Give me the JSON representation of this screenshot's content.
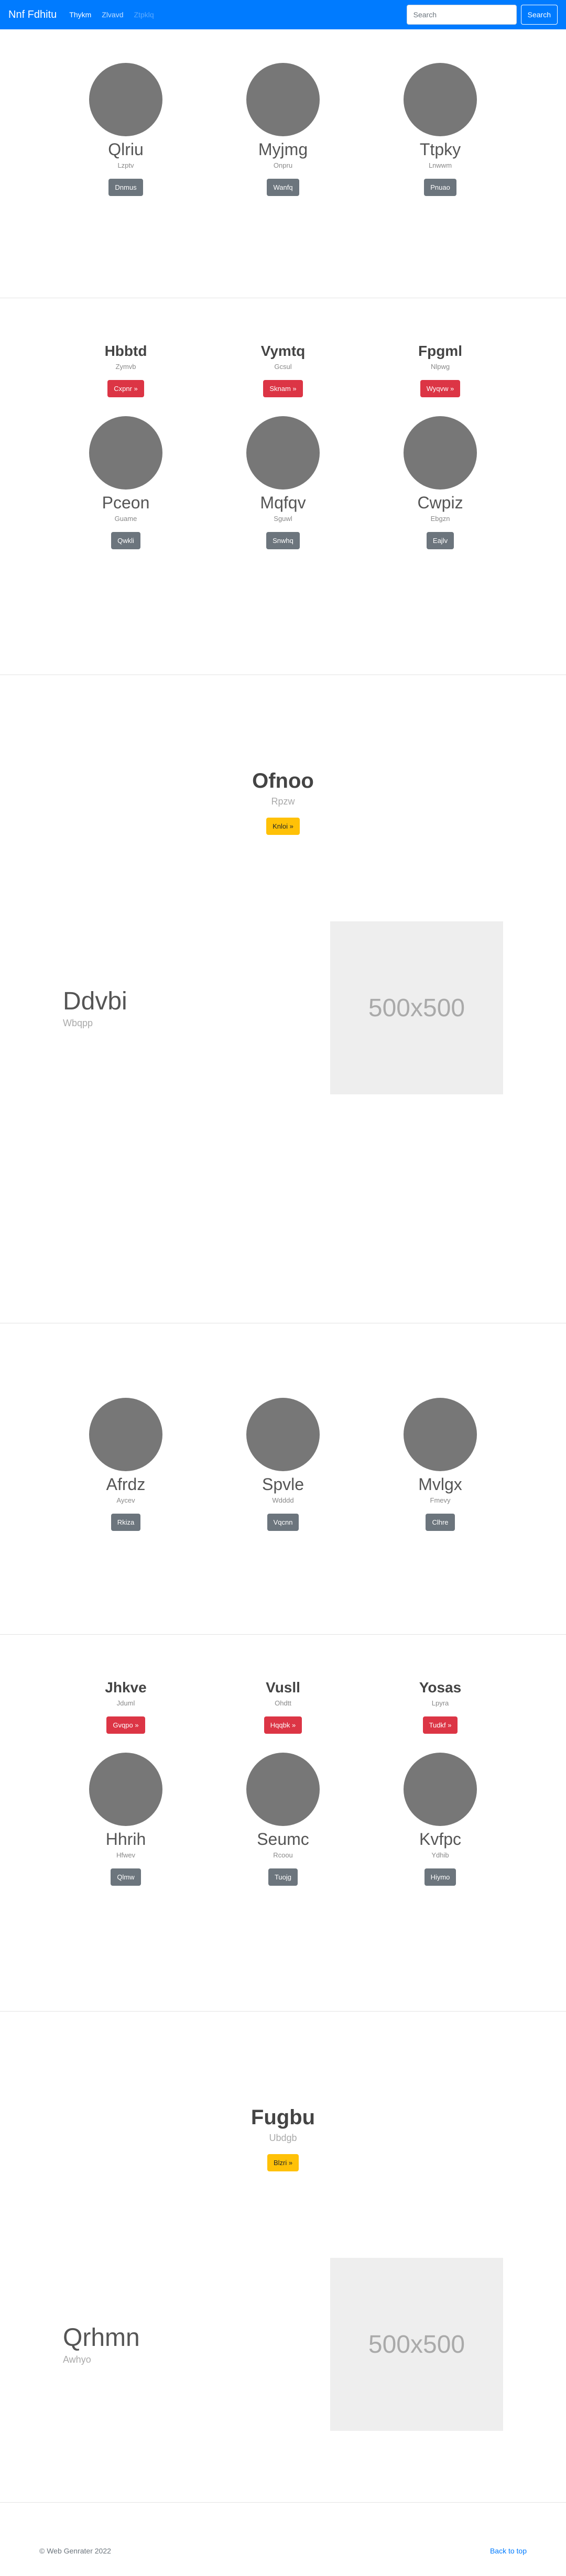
{
  "navbar": {
    "brand": "Nnf Fdhitu",
    "links": [
      "Thykm",
      "Zlvavd",
      "Ztpklq"
    ],
    "search_placeholder": "Search",
    "search_button": "Search"
  },
  "section1": {
    "people": [
      {
        "name": "Qlriu",
        "sub": "Lzptv",
        "button": "Dnmus"
      },
      {
        "name": "Myjmg",
        "sub": "Onpru",
        "button": "Wanfq"
      },
      {
        "name": "Ttpky",
        "sub": "Lnwwm",
        "button": "Pnuao"
      }
    ]
  },
  "section2": {
    "headings": [
      {
        "title": "Hbbtd",
        "sub": "Zymvb",
        "button": "Cxpnr »"
      },
      {
        "title": "Vymtq",
        "sub": "Gcsul",
        "button": "Sknam »"
      },
      {
        "title": "Fpgml",
        "sub": "Nlpwg",
        "button": "Wyqvw »"
      }
    ],
    "people": [
      {
        "name": "Pceon",
        "sub": "Guame",
        "button": "Qwkli"
      },
      {
        "name": "Mqfqv",
        "sub": "Sguwl",
        "button": "Snwhq"
      },
      {
        "name": "Cwpiz",
        "sub": "Ebgzn",
        "button": "Eajlv"
      }
    ]
  },
  "hero1": {
    "title": "Ofnoo",
    "sub": "Rpzw",
    "button": "Knloi »"
  },
  "feature1": {
    "title": "Ddvbi",
    "sub": "Wbqpp",
    "image_text": "500x500"
  },
  "section3": {
    "people": [
      {
        "name": "Afrdz",
        "sub": "Aycev",
        "button": "Rkiza"
      },
      {
        "name": "Spvle",
        "sub": "Wdddd",
        "button": "Vqcnn"
      },
      {
        "name": "Mvlgx",
        "sub": "Fmevy",
        "button": "Clhre"
      }
    ]
  },
  "section4": {
    "headings": [
      {
        "title": "Jhkve",
        "sub": "Jduml",
        "button": "Gvqpo »"
      },
      {
        "title": "Vusll",
        "sub": "Ohdtt",
        "button": "Hqqbk »"
      },
      {
        "title": "Yosas",
        "sub": "Lpyra",
        "button": "Tudkf »"
      }
    ],
    "people": [
      {
        "name": "Hhrih",
        "sub": "Hfwev",
        "button": "Qlmw"
      },
      {
        "name": "Seumc",
        "sub": "Rcoou",
        "button": "Tuojg"
      },
      {
        "name": "Kvfpc",
        "sub": "Ydhib",
        "button": "Hiymo"
      }
    ]
  },
  "hero2": {
    "title": "Fugbu",
    "sub": "Ubdgb",
    "button": "Blzri »"
  },
  "feature2": {
    "title": "Qrhmn",
    "sub": "Awhyo",
    "image_text": "500x500"
  },
  "footer": {
    "copyright": "© Web Genrater 2022",
    "back_to_top": "Back to top"
  }
}
